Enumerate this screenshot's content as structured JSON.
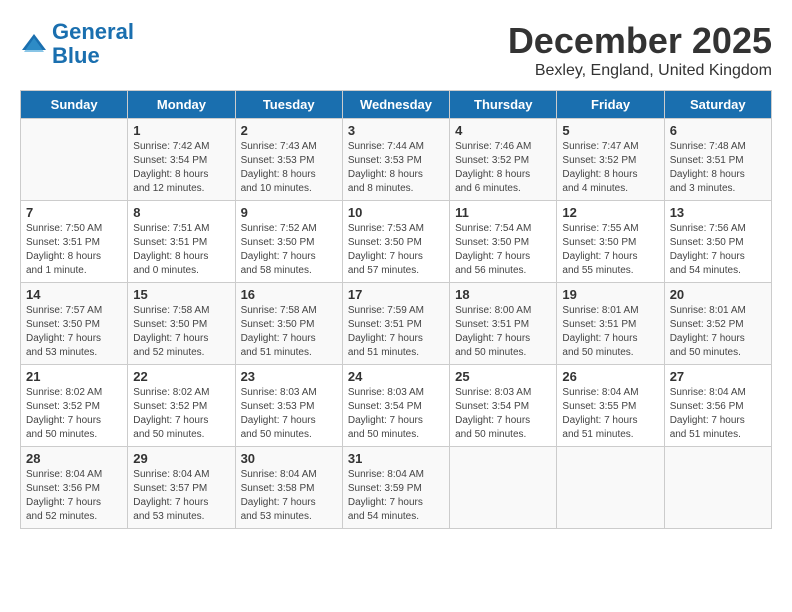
{
  "header": {
    "logo_line1": "General",
    "logo_line2": "Blue",
    "month_title": "December 2025",
    "location": "Bexley, England, United Kingdom"
  },
  "days_of_week": [
    "Sunday",
    "Monday",
    "Tuesday",
    "Wednesday",
    "Thursday",
    "Friday",
    "Saturday"
  ],
  "weeks": [
    [
      {
        "day": "",
        "info": ""
      },
      {
        "day": "1",
        "info": "Sunrise: 7:42 AM\nSunset: 3:54 PM\nDaylight: 8 hours\nand 12 minutes."
      },
      {
        "day": "2",
        "info": "Sunrise: 7:43 AM\nSunset: 3:53 PM\nDaylight: 8 hours\nand 10 minutes."
      },
      {
        "day": "3",
        "info": "Sunrise: 7:44 AM\nSunset: 3:53 PM\nDaylight: 8 hours\nand 8 minutes."
      },
      {
        "day": "4",
        "info": "Sunrise: 7:46 AM\nSunset: 3:52 PM\nDaylight: 8 hours\nand 6 minutes."
      },
      {
        "day": "5",
        "info": "Sunrise: 7:47 AM\nSunset: 3:52 PM\nDaylight: 8 hours\nand 4 minutes."
      },
      {
        "day": "6",
        "info": "Sunrise: 7:48 AM\nSunset: 3:51 PM\nDaylight: 8 hours\nand 3 minutes."
      }
    ],
    [
      {
        "day": "7",
        "info": "Sunrise: 7:50 AM\nSunset: 3:51 PM\nDaylight: 8 hours\nand 1 minute."
      },
      {
        "day": "8",
        "info": "Sunrise: 7:51 AM\nSunset: 3:51 PM\nDaylight: 8 hours\nand 0 minutes."
      },
      {
        "day": "9",
        "info": "Sunrise: 7:52 AM\nSunset: 3:50 PM\nDaylight: 7 hours\nand 58 minutes."
      },
      {
        "day": "10",
        "info": "Sunrise: 7:53 AM\nSunset: 3:50 PM\nDaylight: 7 hours\nand 57 minutes."
      },
      {
        "day": "11",
        "info": "Sunrise: 7:54 AM\nSunset: 3:50 PM\nDaylight: 7 hours\nand 56 minutes."
      },
      {
        "day": "12",
        "info": "Sunrise: 7:55 AM\nSunset: 3:50 PM\nDaylight: 7 hours\nand 55 minutes."
      },
      {
        "day": "13",
        "info": "Sunrise: 7:56 AM\nSunset: 3:50 PM\nDaylight: 7 hours\nand 54 minutes."
      }
    ],
    [
      {
        "day": "14",
        "info": "Sunrise: 7:57 AM\nSunset: 3:50 PM\nDaylight: 7 hours\nand 53 minutes."
      },
      {
        "day": "15",
        "info": "Sunrise: 7:58 AM\nSunset: 3:50 PM\nDaylight: 7 hours\nand 52 minutes."
      },
      {
        "day": "16",
        "info": "Sunrise: 7:58 AM\nSunset: 3:50 PM\nDaylight: 7 hours\nand 51 minutes."
      },
      {
        "day": "17",
        "info": "Sunrise: 7:59 AM\nSunset: 3:51 PM\nDaylight: 7 hours\nand 51 minutes."
      },
      {
        "day": "18",
        "info": "Sunrise: 8:00 AM\nSunset: 3:51 PM\nDaylight: 7 hours\nand 50 minutes."
      },
      {
        "day": "19",
        "info": "Sunrise: 8:01 AM\nSunset: 3:51 PM\nDaylight: 7 hours\nand 50 minutes."
      },
      {
        "day": "20",
        "info": "Sunrise: 8:01 AM\nSunset: 3:52 PM\nDaylight: 7 hours\nand 50 minutes."
      }
    ],
    [
      {
        "day": "21",
        "info": "Sunrise: 8:02 AM\nSunset: 3:52 PM\nDaylight: 7 hours\nand 50 minutes."
      },
      {
        "day": "22",
        "info": "Sunrise: 8:02 AM\nSunset: 3:52 PM\nDaylight: 7 hours\nand 50 minutes."
      },
      {
        "day": "23",
        "info": "Sunrise: 8:03 AM\nSunset: 3:53 PM\nDaylight: 7 hours\nand 50 minutes."
      },
      {
        "day": "24",
        "info": "Sunrise: 8:03 AM\nSunset: 3:54 PM\nDaylight: 7 hours\nand 50 minutes."
      },
      {
        "day": "25",
        "info": "Sunrise: 8:03 AM\nSunset: 3:54 PM\nDaylight: 7 hours\nand 50 minutes."
      },
      {
        "day": "26",
        "info": "Sunrise: 8:04 AM\nSunset: 3:55 PM\nDaylight: 7 hours\nand 51 minutes."
      },
      {
        "day": "27",
        "info": "Sunrise: 8:04 AM\nSunset: 3:56 PM\nDaylight: 7 hours\nand 51 minutes."
      }
    ],
    [
      {
        "day": "28",
        "info": "Sunrise: 8:04 AM\nSunset: 3:56 PM\nDaylight: 7 hours\nand 52 minutes."
      },
      {
        "day": "29",
        "info": "Sunrise: 8:04 AM\nSunset: 3:57 PM\nDaylight: 7 hours\nand 53 minutes."
      },
      {
        "day": "30",
        "info": "Sunrise: 8:04 AM\nSunset: 3:58 PM\nDaylight: 7 hours\nand 53 minutes."
      },
      {
        "day": "31",
        "info": "Sunrise: 8:04 AM\nSunset: 3:59 PM\nDaylight: 7 hours\nand 54 minutes."
      },
      {
        "day": "",
        "info": ""
      },
      {
        "day": "",
        "info": ""
      },
      {
        "day": "",
        "info": ""
      }
    ]
  ]
}
